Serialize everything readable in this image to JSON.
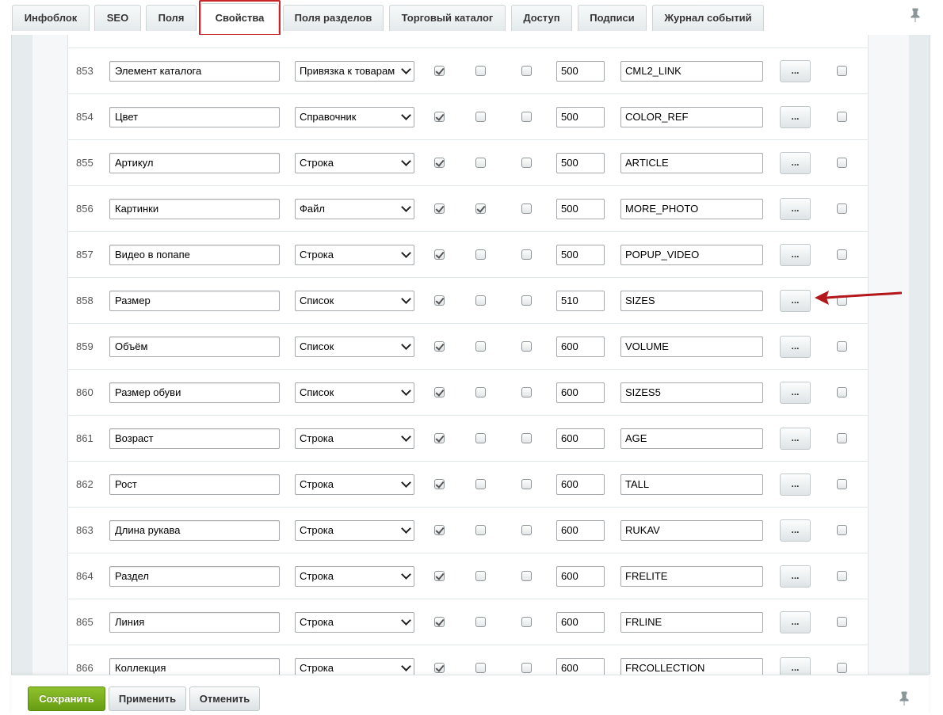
{
  "tabs": [
    {
      "label": "Инфоблок"
    },
    {
      "label": "SEO"
    },
    {
      "label": "Поля"
    },
    {
      "label": "Свойства"
    },
    {
      "label": "Поля разделов"
    },
    {
      "label": "Торговый каталог"
    },
    {
      "label": "Доступ"
    },
    {
      "label": "Подписи"
    },
    {
      "label": "Журнал событий"
    }
  ],
  "active_tab": "Свойства",
  "properties": [
    {
      "id": "853",
      "name": "Элемент каталога",
      "type": "Привязка к товарам",
      "active": true,
      "multiple": false,
      "required": false,
      "sort": "500",
      "code": "CML2_LINK",
      "more_label": "...",
      "delete": false
    },
    {
      "id": "854",
      "name": "Цвет",
      "type": "Справочник",
      "active": true,
      "multiple": false,
      "required": false,
      "sort": "500",
      "code": "COLOR_REF",
      "more_label": "...",
      "delete": false
    },
    {
      "id": "855",
      "name": "Артикул",
      "type": "Строка",
      "active": true,
      "multiple": false,
      "required": false,
      "sort": "500",
      "code": "ARTICLE",
      "more_label": "...",
      "delete": false
    },
    {
      "id": "856",
      "name": "Картинки",
      "type": "Файл",
      "active": true,
      "multiple": true,
      "required": false,
      "sort": "500",
      "code": "MORE_PHOTO",
      "more_label": "...",
      "delete": false
    },
    {
      "id": "857",
      "name": "Видео в попапе",
      "type": "Строка",
      "active": true,
      "multiple": false,
      "required": false,
      "sort": "500",
      "code": "POPUP_VIDEO",
      "more_label": "...",
      "delete": false
    },
    {
      "id": "858",
      "name": "Размер",
      "type": "Список",
      "active": true,
      "multiple": false,
      "required": false,
      "sort": "510",
      "code": "SIZES",
      "more_label": "...",
      "delete": false
    },
    {
      "id": "859",
      "name": "Объём",
      "type": "Список",
      "active": true,
      "multiple": false,
      "required": false,
      "sort": "600",
      "code": "VOLUME",
      "more_label": "...",
      "delete": false
    },
    {
      "id": "860",
      "name": "Размер обуви",
      "type": "Список",
      "active": true,
      "multiple": false,
      "required": false,
      "sort": "600",
      "code": "SIZES5",
      "more_label": "...",
      "delete": false
    },
    {
      "id": "861",
      "name": "Возраст",
      "type": "Строка",
      "active": true,
      "multiple": false,
      "required": false,
      "sort": "600",
      "code": "AGE",
      "more_label": "...",
      "delete": false
    },
    {
      "id": "862",
      "name": "Рост",
      "type": "Строка",
      "active": true,
      "multiple": false,
      "required": false,
      "sort": "600",
      "code": "TALL",
      "more_label": "...",
      "delete": false
    },
    {
      "id": "863",
      "name": "Длина рукава",
      "type": "Строка",
      "active": true,
      "multiple": false,
      "required": false,
      "sort": "600",
      "code": "RUKAV",
      "more_label": "...",
      "delete": false
    },
    {
      "id": "864",
      "name": "Раздел",
      "type": "Строка",
      "active": true,
      "multiple": false,
      "required": false,
      "sort": "600",
      "code": "FRELITE",
      "more_label": "...",
      "delete": false
    },
    {
      "id": "865",
      "name": "Линия",
      "type": "Строка",
      "active": true,
      "multiple": false,
      "required": false,
      "sort": "600",
      "code": "FRLINE",
      "more_label": "...",
      "delete": false
    },
    {
      "id": "866",
      "name": "Коллекция",
      "type": "Строка",
      "active": true,
      "multiple": false,
      "required": false,
      "sort": "600",
      "code": "FRCOLLECTION",
      "more_label": "...",
      "delete": false
    }
  ],
  "footer": {
    "save_label": "Сохранить",
    "apply_label": "Применить",
    "cancel_label": "Отменить"
  },
  "icons": {
    "tab_pin": "pin-icon",
    "footer_pin": "pin-icon",
    "annotation": "red-arrow-icon"
  },
  "colors": {
    "highlight": "#c8252a",
    "save_button": "#7aaf1d",
    "arrow": "#b3171c"
  }
}
